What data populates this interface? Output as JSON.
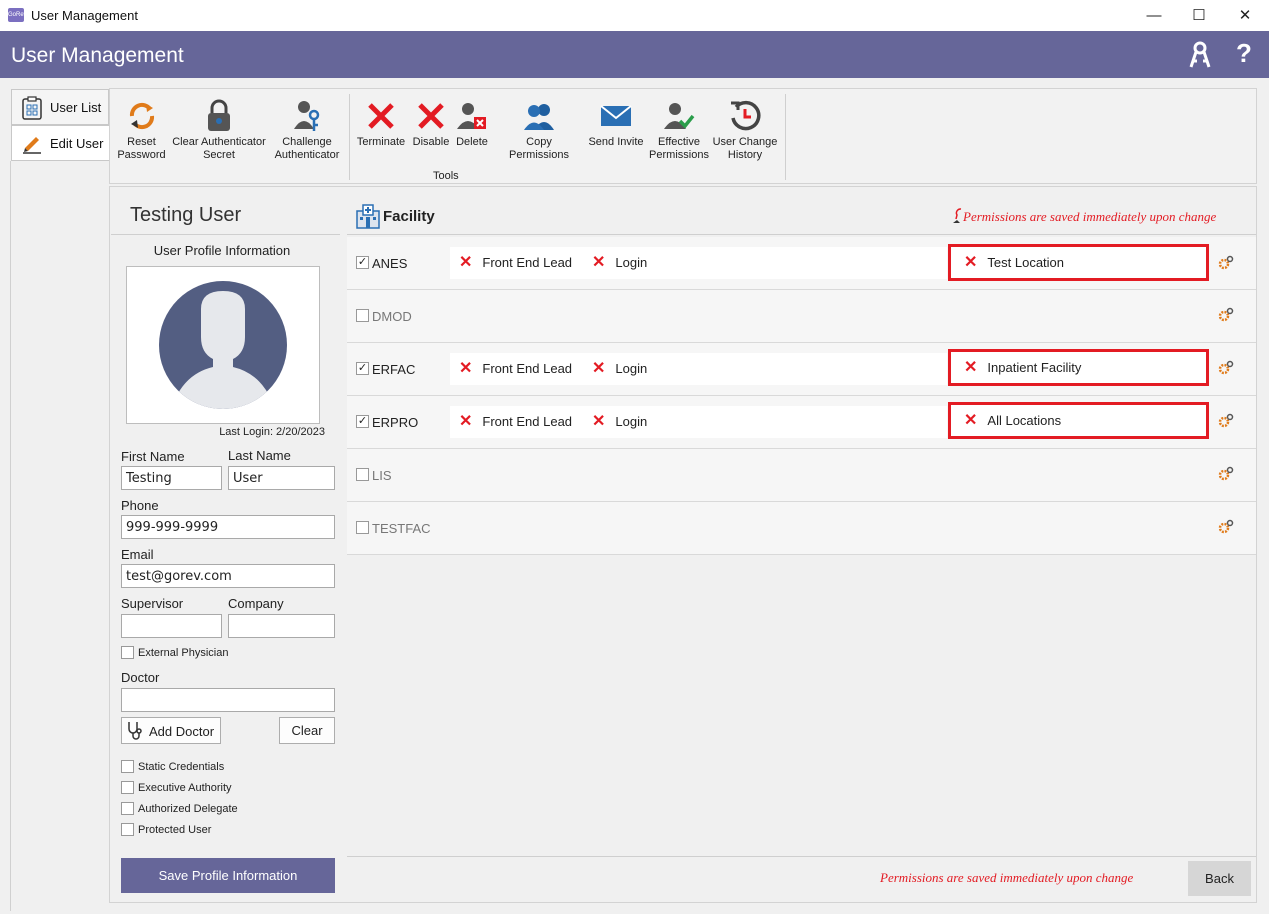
{
  "window": {
    "title": "User Management",
    "app_icon_text": "GoRev"
  },
  "header": {
    "title": "User Management"
  },
  "side_tabs": [
    {
      "label": "User List"
    },
    {
      "label": "Edit User"
    }
  ],
  "toolbar": {
    "tools": [
      {
        "label1": "Reset",
        "label2": "Password",
        "icon": "refresh-icon"
      },
      {
        "label1": "Clear Authenticator",
        "label2": "Secret",
        "icon": "lock-icon"
      },
      {
        "label1": "Challenge",
        "label2": "Authenticator",
        "icon": "user-key-icon"
      },
      {
        "label1": "Terminate",
        "label2": "",
        "icon": "x-icon"
      },
      {
        "label1": "Disable",
        "label2": "",
        "icon": "x-icon"
      },
      {
        "label1": "Delete",
        "label2": "",
        "icon": "user-delete-icon"
      },
      {
        "label1": "Copy Permissions",
        "label2": "",
        "icon": "users-icon"
      },
      {
        "label1": "Send Invite",
        "label2": "",
        "icon": "envelope-icon"
      },
      {
        "label1": "Effective",
        "label2": "Permissions",
        "icon": "user-check-icon"
      },
      {
        "label1": "User Change",
        "label2": "History",
        "icon": "history-icon"
      }
    ],
    "group_caption": "Tools"
  },
  "profile": {
    "user_name": "Testing User",
    "section_title": "User Profile Information",
    "last_login": "Last Login: 2/20/2023",
    "first_name_label": "First Name",
    "first_name": "Testing",
    "last_name_label": "Last Name",
    "last_name": "User",
    "phone_label": "Phone",
    "phone": "999-999-9999",
    "email_label": "Email",
    "email": "test@gorev.com",
    "supervisor_label": "Supervisor",
    "supervisor": "",
    "company_label": "Company",
    "company": "",
    "external_physician_label": "External Physician",
    "doctor_label": "Doctor",
    "doctor": "",
    "add_doctor_label": "Add Doctor",
    "clear_label": "Clear",
    "flags": [
      {
        "label": "Static Credentials",
        "checked": false
      },
      {
        "label": "Executive Authority",
        "checked": false
      },
      {
        "label": "Authorized Delegate",
        "checked": false
      },
      {
        "label": "Protected User",
        "checked": false
      }
    ],
    "save_label": "Save Profile Information"
  },
  "facility": {
    "title": "Facility",
    "note": "Permissions are saved immediately upon change",
    "rows": [
      {
        "code": "ANES",
        "checked": true,
        "roles": [
          "Front End Lead",
          "Login"
        ],
        "location": "Test Location"
      },
      {
        "code": "DMOD",
        "checked": false,
        "roles": [],
        "location": ""
      },
      {
        "code": "ERFAC",
        "checked": true,
        "roles": [
          "Front End Lead",
          "Login"
        ],
        "location": "Inpatient Facility"
      },
      {
        "code": "ERPRO",
        "checked": true,
        "roles": [
          "Front End Lead",
          "Login"
        ],
        "location": "All Locations"
      },
      {
        "code": "LIS",
        "checked": false,
        "roles": [],
        "location": ""
      },
      {
        "code": "TESTFAC",
        "checked": false,
        "roles": [],
        "location": ""
      }
    ]
  },
  "footer": {
    "note": "Permissions are saved immediately upon change",
    "back_label": "Back"
  },
  "colors": {
    "header": "#666699",
    "accent_red": "#e31b23",
    "icon_blue": "#2a6fb4",
    "icon_orange": "#e07b1a"
  }
}
